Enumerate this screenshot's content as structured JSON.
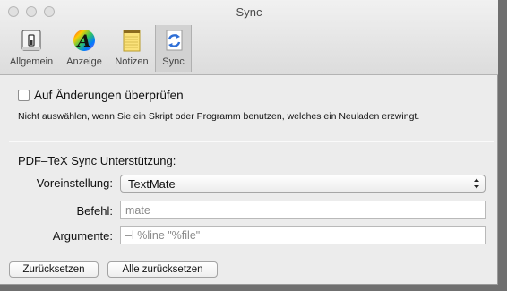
{
  "window": {
    "title": "Sync"
  },
  "toolbar": {
    "items": [
      {
        "label": "Allgemein",
        "icon": "switch-icon"
      },
      {
        "label": "Anzeige",
        "icon": "color-font-icon"
      },
      {
        "label": "Notizen",
        "icon": "notepad-icon"
      },
      {
        "label": "Sync",
        "icon": "sync-icon",
        "selected": true
      }
    ]
  },
  "sync": {
    "check_label": "Auf Änderungen überprüfen",
    "check_hint": "Nicht auswählen, wenn Sie ein Skript oder Programm benutzen, welches ein Neuladen erzwingt.",
    "checked": false,
    "section_title": "PDF–TeX Sync Unterstützung:",
    "preset_label": "Voreinstellung:",
    "preset_value": "TextMate",
    "command_label": "Befehl:",
    "command_value": "mate",
    "args_label": "Argumente:",
    "args_value": "–l %line \"%file\""
  },
  "buttons": {
    "reset": "Zurücksetzen",
    "reset_all": "Alle zurücksetzen"
  }
}
